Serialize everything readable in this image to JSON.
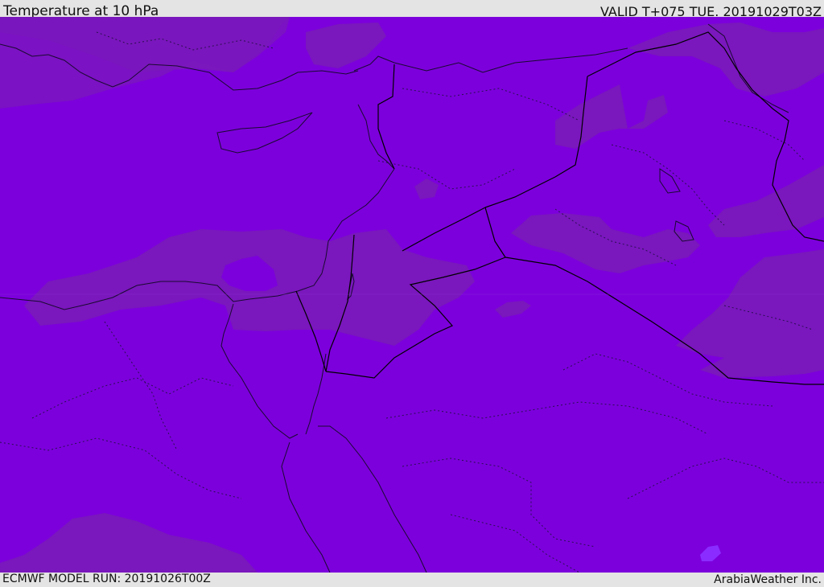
{
  "header": {
    "title": "Temperature at 10 hPa",
    "valid_time": "VALID T+075 TUE. 20191029T03Z"
  },
  "footer": {
    "model_run": "ECMWF MODEL RUN: 20191026T00Z",
    "credit": "ArabiaWeather Inc."
  },
  "map": {
    "colors": {
      "field_base": "#7c00dc",
      "field_warm_band": "#7a17bd",
      "field_cold_spot": "#8a2cff",
      "coastline": "#1a0a30",
      "borders": "#000000",
      "admin_borders": "#2a1050"
    }
  }
}
